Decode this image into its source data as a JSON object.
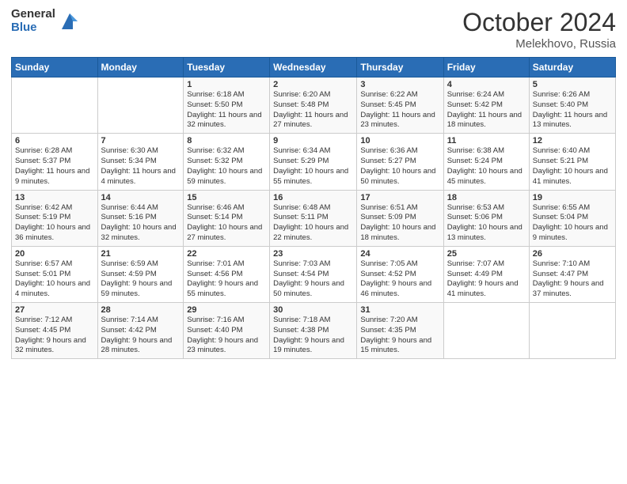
{
  "logo": {
    "general": "General",
    "blue": "Blue"
  },
  "title": {
    "month": "October 2024",
    "location": "Melekhovo, Russia"
  },
  "weekdays": [
    "Sunday",
    "Monday",
    "Tuesday",
    "Wednesday",
    "Thursday",
    "Friday",
    "Saturday"
  ],
  "weeks": [
    [
      {
        "day": "",
        "sunrise": "",
        "sunset": "",
        "daylight": ""
      },
      {
        "day": "",
        "sunrise": "",
        "sunset": "",
        "daylight": ""
      },
      {
        "day": "1",
        "sunrise": "Sunrise: 6:18 AM",
        "sunset": "Sunset: 5:50 PM",
        "daylight": "Daylight: 11 hours and 32 minutes."
      },
      {
        "day": "2",
        "sunrise": "Sunrise: 6:20 AM",
        "sunset": "Sunset: 5:48 PM",
        "daylight": "Daylight: 11 hours and 27 minutes."
      },
      {
        "day": "3",
        "sunrise": "Sunrise: 6:22 AM",
        "sunset": "Sunset: 5:45 PM",
        "daylight": "Daylight: 11 hours and 23 minutes."
      },
      {
        "day": "4",
        "sunrise": "Sunrise: 6:24 AM",
        "sunset": "Sunset: 5:42 PM",
        "daylight": "Daylight: 11 hours and 18 minutes."
      },
      {
        "day": "5",
        "sunrise": "Sunrise: 6:26 AM",
        "sunset": "Sunset: 5:40 PM",
        "daylight": "Daylight: 11 hours and 13 minutes."
      }
    ],
    [
      {
        "day": "6",
        "sunrise": "Sunrise: 6:28 AM",
        "sunset": "Sunset: 5:37 PM",
        "daylight": "Daylight: 11 hours and 9 minutes."
      },
      {
        "day": "7",
        "sunrise": "Sunrise: 6:30 AM",
        "sunset": "Sunset: 5:34 PM",
        "daylight": "Daylight: 11 hours and 4 minutes."
      },
      {
        "day": "8",
        "sunrise": "Sunrise: 6:32 AM",
        "sunset": "Sunset: 5:32 PM",
        "daylight": "Daylight: 10 hours and 59 minutes."
      },
      {
        "day": "9",
        "sunrise": "Sunrise: 6:34 AM",
        "sunset": "Sunset: 5:29 PM",
        "daylight": "Daylight: 10 hours and 55 minutes."
      },
      {
        "day": "10",
        "sunrise": "Sunrise: 6:36 AM",
        "sunset": "Sunset: 5:27 PM",
        "daylight": "Daylight: 10 hours and 50 minutes."
      },
      {
        "day": "11",
        "sunrise": "Sunrise: 6:38 AM",
        "sunset": "Sunset: 5:24 PM",
        "daylight": "Daylight: 10 hours and 45 minutes."
      },
      {
        "day": "12",
        "sunrise": "Sunrise: 6:40 AM",
        "sunset": "Sunset: 5:21 PM",
        "daylight": "Daylight: 10 hours and 41 minutes."
      }
    ],
    [
      {
        "day": "13",
        "sunrise": "Sunrise: 6:42 AM",
        "sunset": "Sunset: 5:19 PM",
        "daylight": "Daylight: 10 hours and 36 minutes."
      },
      {
        "day": "14",
        "sunrise": "Sunrise: 6:44 AM",
        "sunset": "Sunset: 5:16 PM",
        "daylight": "Daylight: 10 hours and 32 minutes."
      },
      {
        "day": "15",
        "sunrise": "Sunrise: 6:46 AM",
        "sunset": "Sunset: 5:14 PM",
        "daylight": "Daylight: 10 hours and 27 minutes."
      },
      {
        "day": "16",
        "sunrise": "Sunrise: 6:48 AM",
        "sunset": "Sunset: 5:11 PM",
        "daylight": "Daylight: 10 hours and 22 minutes."
      },
      {
        "day": "17",
        "sunrise": "Sunrise: 6:51 AM",
        "sunset": "Sunset: 5:09 PM",
        "daylight": "Daylight: 10 hours and 18 minutes."
      },
      {
        "day": "18",
        "sunrise": "Sunrise: 6:53 AM",
        "sunset": "Sunset: 5:06 PM",
        "daylight": "Daylight: 10 hours and 13 minutes."
      },
      {
        "day": "19",
        "sunrise": "Sunrise: 6:55 AM",
        "sunset": "Sunset: 5:04 PM",
        "daylight": "Daylight: 10 hours and 9 minutes."
      }
    ],
    [
      {
        "day": "20",
        "sunrise": "Sunrise: 6:57 AM",
        "sunset": "Sunset: 5:01 PM",
        "daylight": "Daylight: 10 hours and 4 minutes."
      },
      {
        "day": "21",
        "sunrise": "Sunrise: 6:59 AM",
        "sunset": "Sunset: 4:59 PM",
        "daylight": "Daylight: 9 hours and 59 minutes."
      },
      {
        "day": "22",
        "sunrise": "Sunrise: 7:01 AM",
        "sunset": "Sunset: 4:56 PM",
        "daylight": "Daylight: 9 hours and 55 minutes."
      },
      {
        "day": "23",
        "sunrise": "Sunrise: 7:03 AM",
        "sunset": "Sunset: 4:54 PM",
        "daylight": "Daylight: 9 hours and 50 minutes."
      },
      {
        "day": "24",
        "sunrise": "Sunrise: 7:05 AM",
        "sunset": "Sunset: 4:52 PM",
        "daylight": "Daylight: 9 hours and 46 minutes."
      },
      {
        "day": "25",
        "sunrise": "Sunrise: 7:07 AM",
        "sunset": "Sunset: 4:49 PM",
        "daylight": "Daylight: 9 hours and 41 minutes."
      },
      {
        "day": "26",
        "sunrise": "Sunrise: 7:10 AM",
        "sunset": "Sunset: 4:47 PM",
        "daylight": "Daylight: 9 hours and 37 minutes."
      }
    ],
    [
      {
        "day": "27",
        "sunrise": "Sunrise: 7:12 AM",
        "sunset": "Sunset: 4:45 PM",
        "daylight": "Daylight: 9 hours and 32 minutes."
      },
      {
        "day": "28",
        "sunrise": "Sunrise: 7:14 AM",
        "sunset": "Sunset: 4:42 PM",
        "daylight": "Daylight: 9 hours and 28 minutes."
      },
      {
        "day": "29",
        "sunrise": "Sunrise: 7:16 AM",
        "sunset": "Sunset: 4:40 PM",
        "daylight": "Daylight: 9 hours and 23 minutes."
      },
      {
        "day": "30",
        "sunrise": "Sunrise: 7:18 AM",
        "sunset": "Sunset: 4:38 PM",
        "daylight": "Daylight: 9 hours and 19 minutes."
      },
      {
        "day": "31",
        "sunrise": "Sunrise: 7:20 AM",
        "sunset": "Sunset: 4:35 PM",
        "daylight": "Daylight: 9 hours and 15 minutes."
      },
      {
        "day": "",
        "sunrise": "",
        "sunset": "",
        "daylight": ""
      },
      {
        "day": "",
        "sunrise": "",
        "sunset": "",
        "daylight": ""
      }
    ]
  ]
}
